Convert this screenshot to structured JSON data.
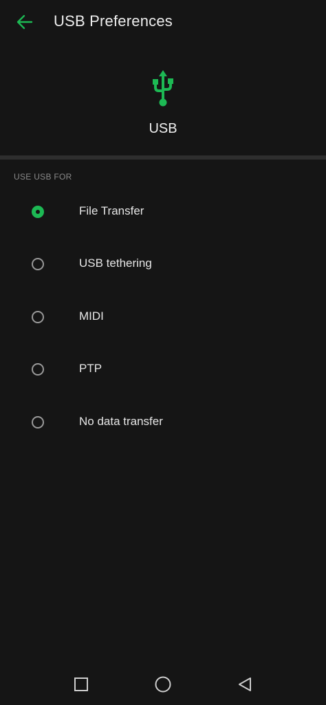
{
  "app_bar": {
    "title": "USB Preferences",
    "back_icon": "arrow-left-icon"
  },
  "hero": {
    "icon": "usb-icon",
    "label": "USB"
  },
  "section": {
    "header": "USE USB FOR"
  },
  "options": [
    {
      "label": "File Transfer",
      "selected": true
    },
    {
      "label": "USB tethering",
      "selected": false
    },
    {
      "label": "MIDI",
      "selected": false
    },
    {
      "label": "PTP",
      "selected": false
    },
    {
      "label": "No data transfer",
      "selected": false
    }
  ],
  "nav_bar": {
    "recents_icon": "square-icon",
    "home_icon": "circle-icon",
    "back_icon": "triangle-back-icon"
  },
  "colors": {
    "accent": "#1db954",
    "background": "#151515"
  }
}
